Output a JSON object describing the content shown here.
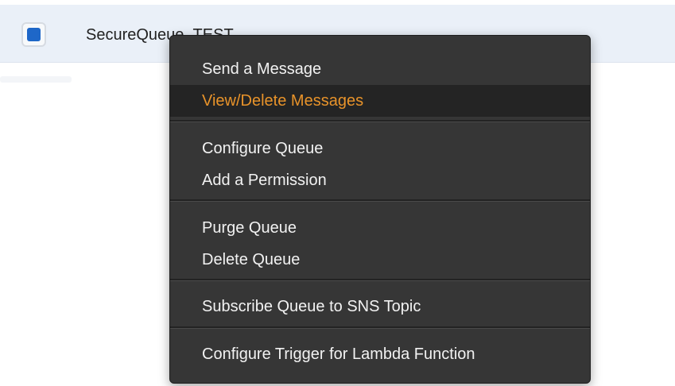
{
  "queue_row": {
    "name": "SecureQueue_TEST",
    "checkbox_color": "#1e67c8",
    "selected": true
  },
  "context_menu": {
    "groups": [
      {
        "items": [
          {
            "label": "Send a Message"
          },
          {
            "label": "View/Delete Messages",
            "highlighted": true
          }
        ]
      },
      {
        "items": [
          {
            "label": "Configure Queue"
          },
          {
            "label": "Add a Permission"
          }
        ]
      },
      {
        "items": [
          {
            "label": "Purge Queue"
          },
          {
            "label": "Delete Queue"
          }
        ]
      },
      {
        "items": [
          {
            "label": "Subscribe Queue to SNS Topic"
          }
        ]
      },
      {
        "items": [
          {
            "label": "Configure Trigger for Lambda Function"
          }
        ]
      }
    ],
    "highlight_color": "#e8932a",
    "background_color": "#363636"
  }
}
